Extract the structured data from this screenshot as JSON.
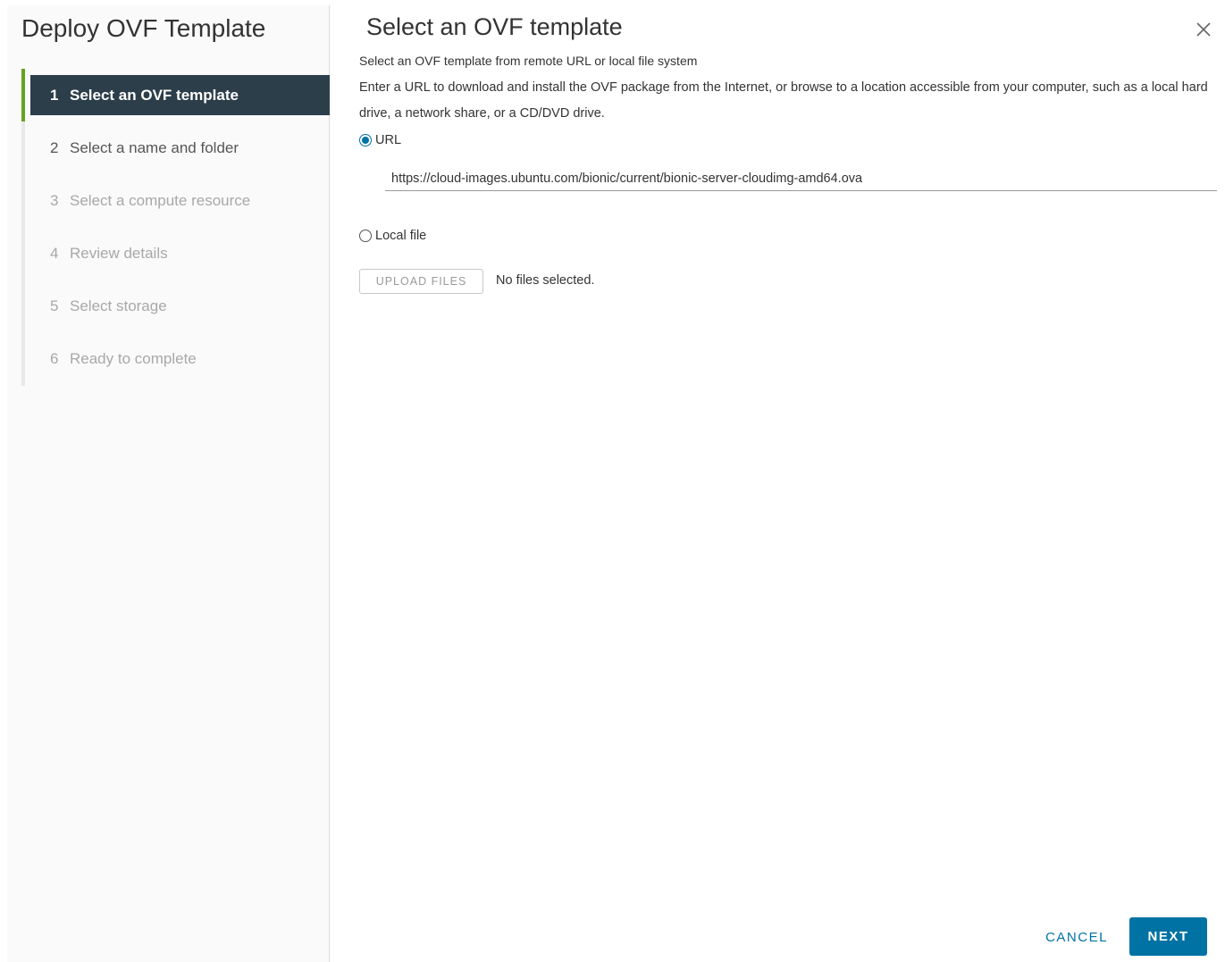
{
  "wizard": {
    "title": "Deploy OVF Template",
    "steps": [
      {
        "number": "1",
        "label": "Select an OVF template",
        "state": "active"
      },
      {
        "number": "2",
        "label": "Select a name and folder",
        "state": "enabled"
      },
      {
        "number": "3",
        "label": "Select a compute resource",
        "state": "disabled"
      },
      {
        "number": "4",
        "label": "Review details",
        "state": "disabled"
      },
      {
        "number": "5",
        "label": "Select storage",
        "state": "disabled"
      },
      {
        "number": "6",
        "label": "Ready to complete",
        "state": "disabled"
      }
    ]
  },
  "page": {
    "title": "Select an OVF template",
    "subtitle": "Select an OVF template from remote URL or local file system",
    "description": "Enter a URL to download and install the OVF package from the Internet, or browse to a location accessible from your computer, such as a local hard drive, a network share, or a CD/DVD drive.",
    "close_icon": "close-icon"
  },
  "source": {
    "selected": "url",
    "url_option_label": "URL",
    "url_value": "https://cloud-images.ubuntu.com/bionic/current/bionic-server-cloudimg-amd64.ova",
    "local_option_label": "Local file",
    "upload_button_label": "UPLOAD FILES",
    "file_status": "No files selected."
  },
  "footer": {
    "cancel_label": "CANCEL",
    "next_label": "NEXT"
  },
  "colors": {
    "accent": "#0072a3",
    "active_step_bg": "#2c3e4a",
    "active_step_marker": "#62a420"
  }
}
